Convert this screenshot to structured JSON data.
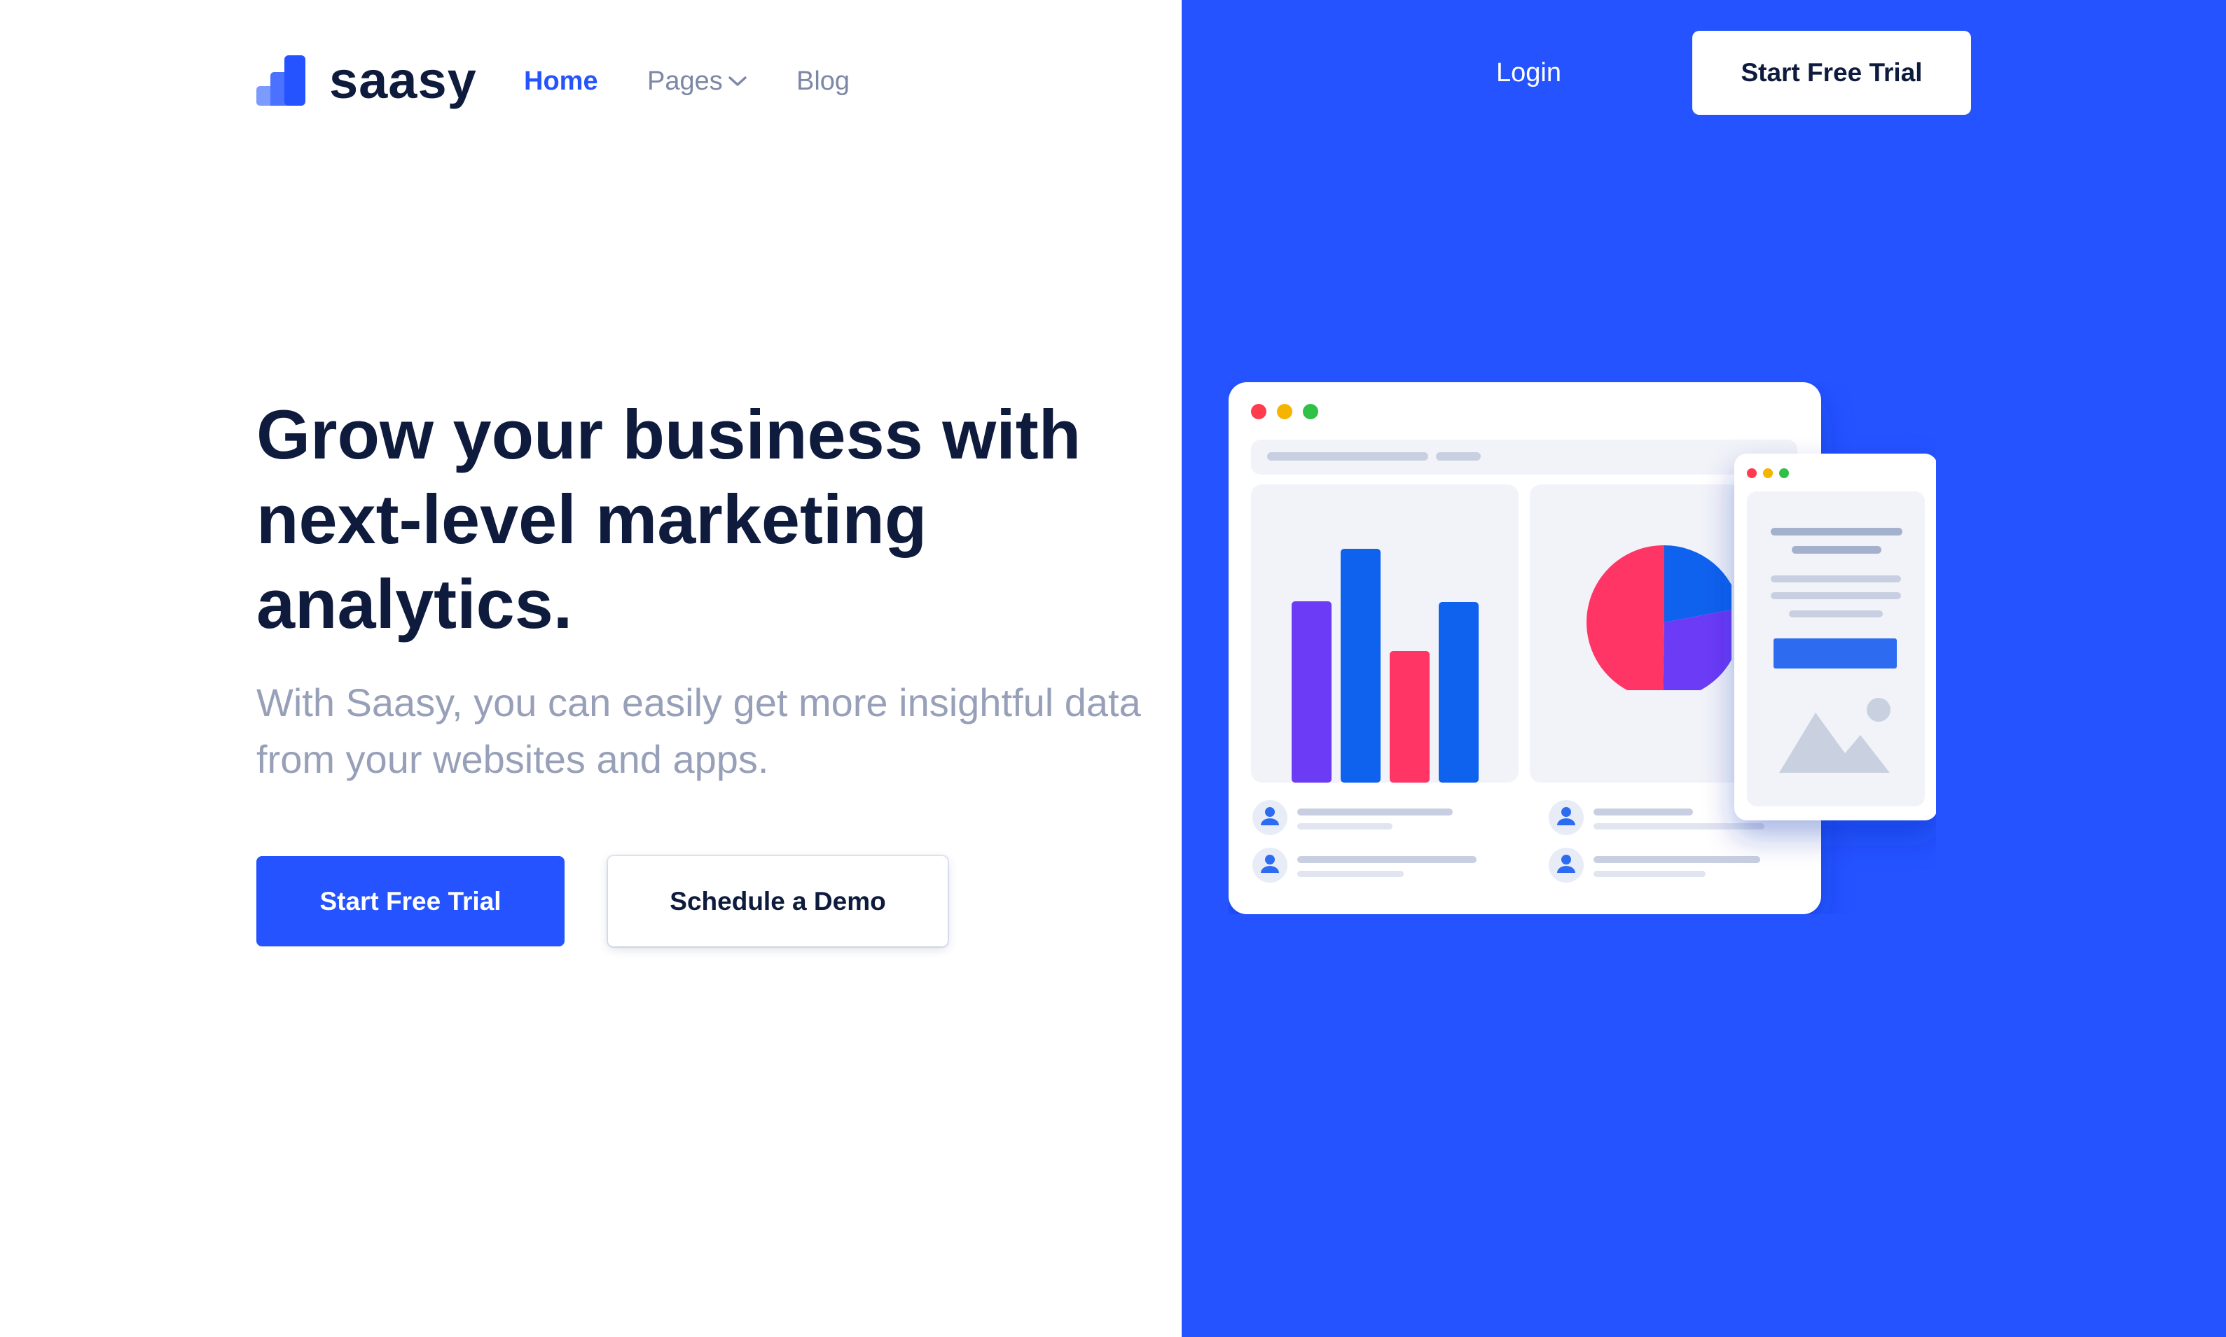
{
  "brand": {
    "name": "saasy"
  },
  "nav": {
    "home": "Home",
    "pages": "Pages",
    "blog": "Blog",
    "login": "Login",
    "cta": "Start Free Trial"
  },
  "hero": {
    "title": "Grow your business with next-level marketing analytics.",
    "subtitle": "With Saasy, you can easily get more insightful data from your websites and apps.",
    "primary_cta": "Start Free Trial",
    "secondary_cta": "Schedule a Demo"
  },
  "colors": {
    "accent": "#2453ff",
    "heading": "#0f1b3d",
    "muted": "#97a0b8",
    "chart_purple": "#6c3bf5",
    "chart_blue": "#0f62ee",
    "chart_pink": "#ff3566"
  },
  "icons": [
    "logo-mark-icon",
    "chevron-down-icon",
    "user-icon",
    "image-placeholder-icon"
  ]
}
